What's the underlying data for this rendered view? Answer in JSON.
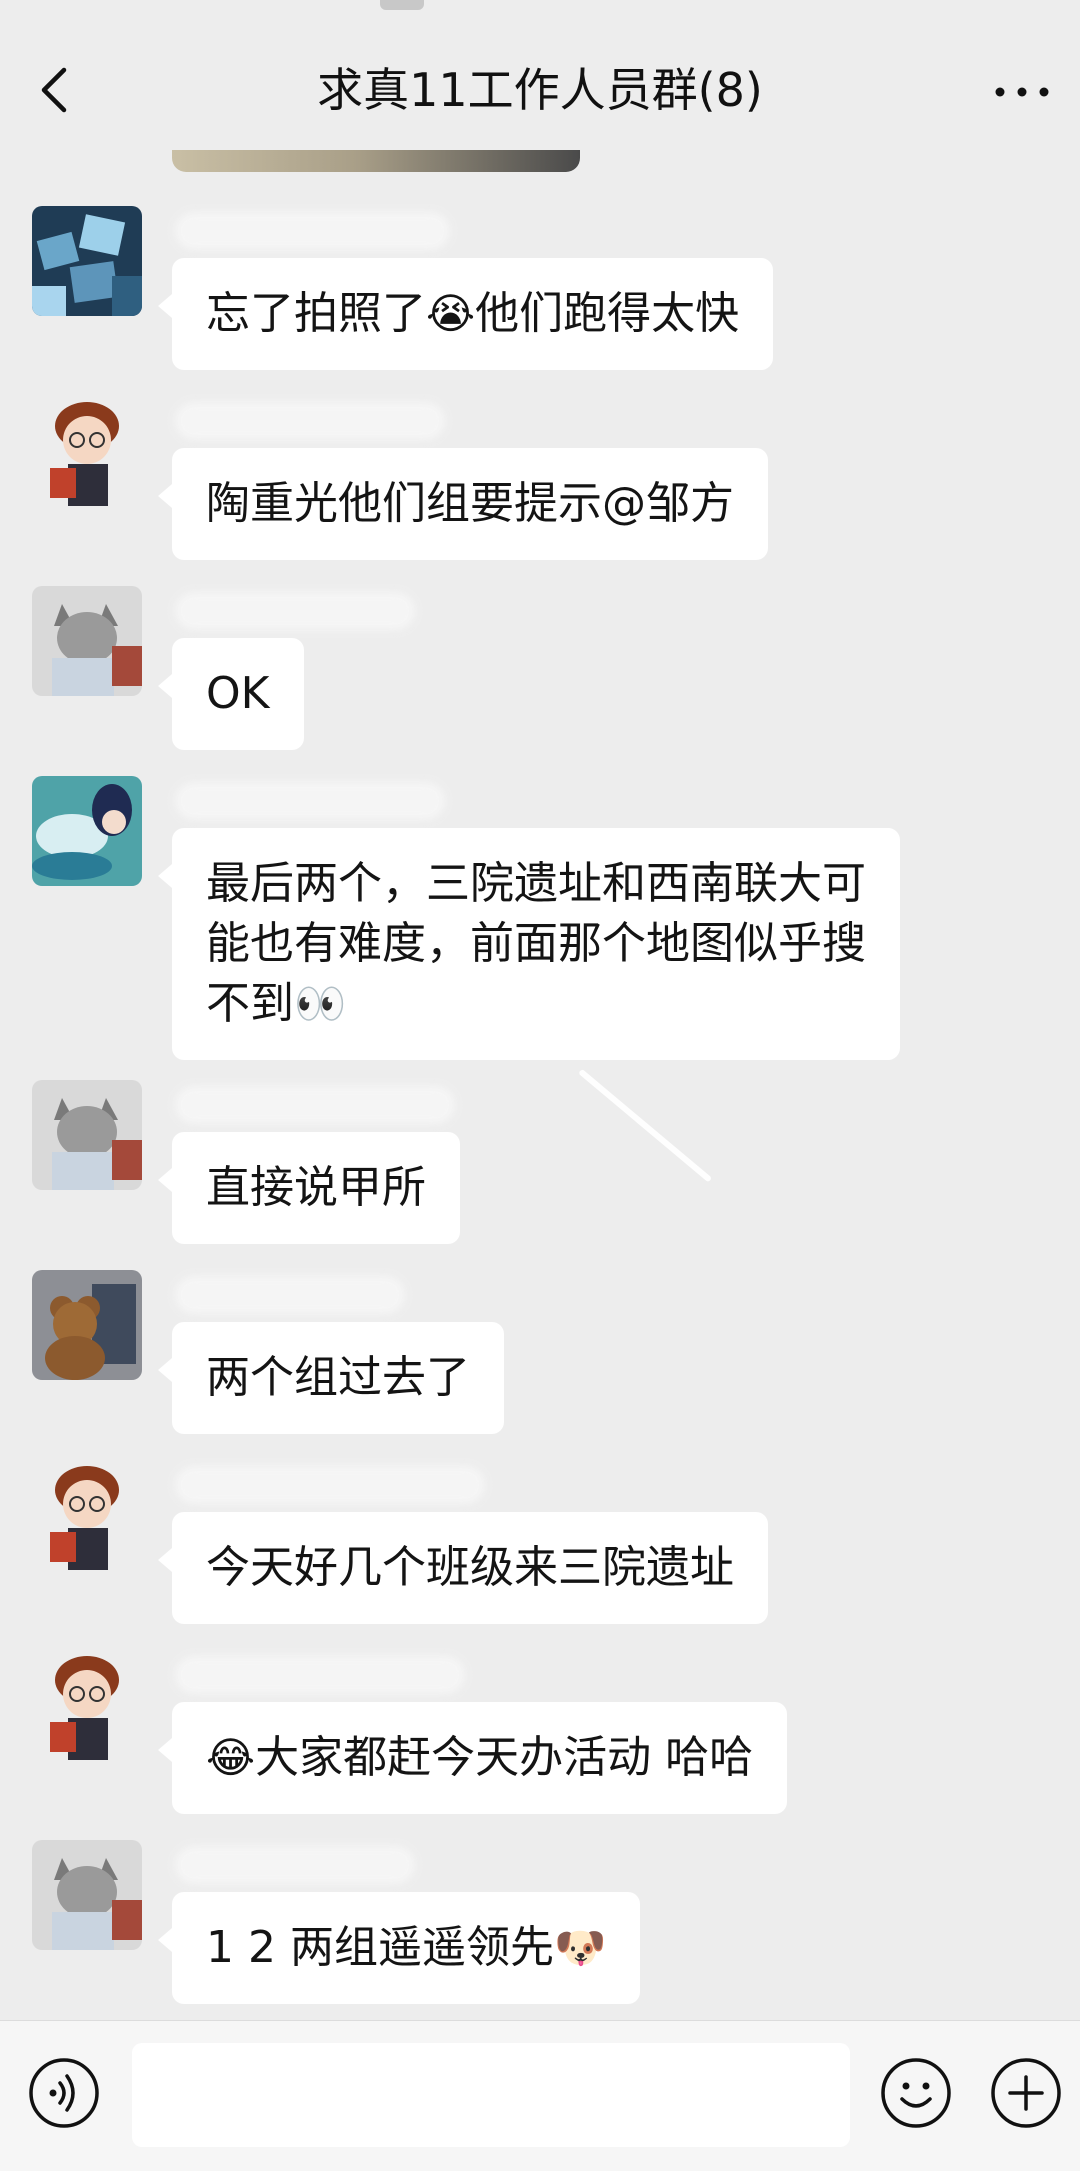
{
  "header": {
    "title": "求真11工作人员群(8)",
    "back_icon": "chevron-left-icon",
    "more_icon": "more-dots-icon"
  },
  "messages": [
    {
      "avatar": "avatar-blue-cubes",
      "text_before": "忘了拍照了",
      "emoji": "😭",
      "text_after": "他们跑得太快"
    },
    {
      "avatar": "avatar-glasses-boy",
      "text_before": "陶重光他们组要提示@邹方",
      "emoji": "",
      "text_after": ""
    },
    {
      "avatar": "avatar-gray-cat",
      "text_before": "OK",
      "emoji": "",
      "text_after": ""
    },
    {
      "avatar": "avatar-anime-water",
      "text_before": "最后两个，三院遗址和西南联大可\n能也有难度，前面那个地图似乎搜\n不到",
      "emoji": "👀",
      "text_after": ""
    },
    {
      "avatar": "avatar-gray-cat",
      "text_before": "直接说甲所",
      "emoji": "",
      "text_after": ""
    },
    {
      "avatar": "avatar-teddy-bear",
      "text_before": "两个组过去了",
      "emoji": "",
      "text_after": ""
    },
    {
      "avatar": "avatar-glasses-boy",
      "text_before": "今天好几个班级来三院遗址",
      "emoji": "",
      "text_after": ""
    },
    {
      "avatar": "avatar-glasses-boy",
      "text_before": "",
      "emoji": "😂",
      "text_after": "大家都赶今天办活动 哈哈"
    },
    {
      "avatar": "avatar-gray-cat",
      "text_before": "1 2 两组遥遥领先",
      "emoji": "🐶",
      "text_after": ""
    }
  ],
  "input_bar": {
    "voice_icon": "voice-icon",
    "emoji_icon": "smiley-icon",
    "plus_icon": "plus-icon",
    "placeholder": ""
  },
  "colors": {
    "background": "#ededed",
    "bubble": "#ffffff",
    "input_bar": "#f6f6f6"
  }
}
